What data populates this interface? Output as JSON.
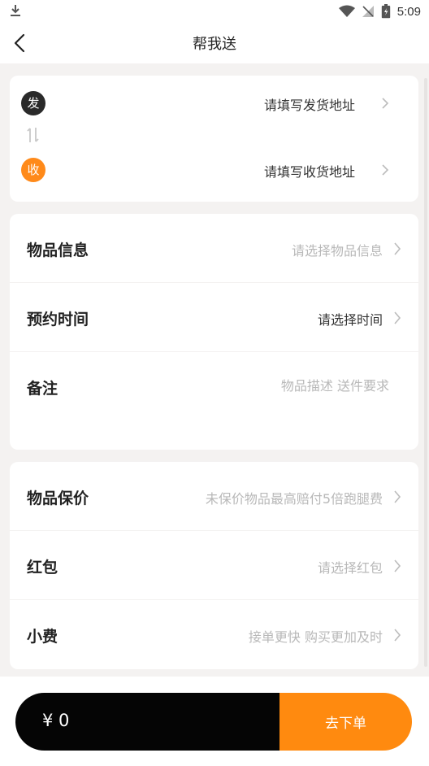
{
  "status_bar": {
    "time": "5:09"
  },
  "nav": {
    "title": "帮我送"
  },
  "address": {
    "send": {
      "badge": "发",
      "placeholder": "请填写发货地址",
      "badge_color": "#2a2a2a"
    },
    "receive": {
      "badge": "收",
      "placeholder": "请填写收货地址",
      "badge_color": "#ff8a1a"
    }
  },
  "info": {
    "item": {
      "label": "物品信息",
      "value": "请选择物品信息"
    },
    "time": {
      "label": "预约时间",
      "value": "请选择时间"
    },
    "note": {
      "label": "备注",
      "placeholder": "物品描述 送件要求"
    }
  },
  "extra": {
    "insurance": {
      "label": "物品保价",
      "value": "未保价物品最高赔付5倍跑腿费"
    },
    "redpacket": {
      "label": "红包",
      "value": "请选择红包"
    },
    "tip": {
      "label": "小费",
      "value": "接单更快 购买更加及时"
    }
  },
  "order": {
    "price": "¥ 0",
    "submit_label": "去下单"
  },
  "colors": {
    "accent": "#ff8a0f",
    "dark": "#050505",
    "background": "#f4f2f1"
  }
}
